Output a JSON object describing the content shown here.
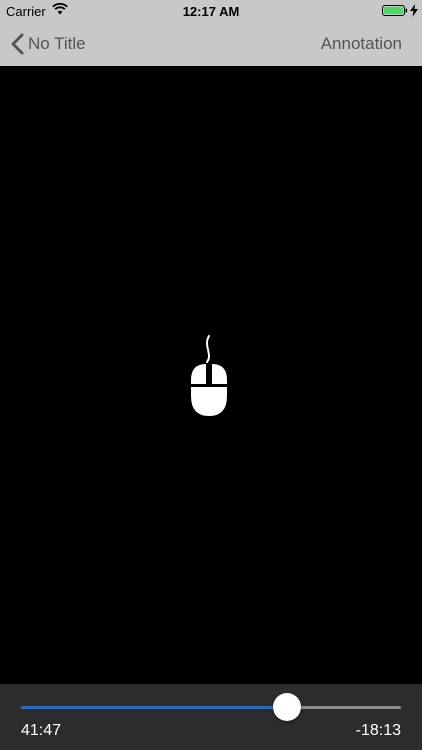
{
  "status": {
    "carrier": "Carrier",
    "time": "12:17 AM",
    "battery_color": "#4cd964"
  },
  "nav": {
    "back_label": "No Title",
    "right_label": "Annotation"
  },
  "player": {
    "elapsed": "41:47",
    "remaining": "-18:13",
    "progress_fraction": 0.7,
    "fill_color": "#1a6fd6",
    "center_icon": "mouse-icon"
  }
}
